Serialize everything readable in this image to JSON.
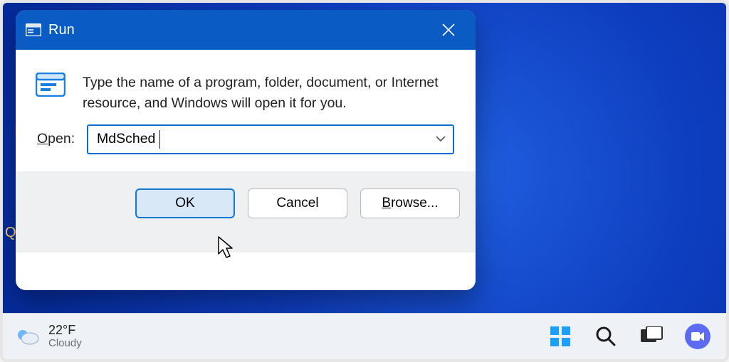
{
  "dialog": {
    "title": "Run",
    "description": "Type the name of a program, folder, document, or Internet resource, and Windows will open it for you.",
    "open_label_prefix": "O",
    "open_label_rest": "pen:",
    "input_value": "MdSched",
    "buttons": {
      "ok": "OK",
      "cancel": "Cancel",
      "browse_prefix": "B",
      "browse_rest": "rowse..."
    }
  },
  "taskbar": {
    "temperature": "22°F",
    "condition": "Cloudy"
  },
  "desktop": {
    "stray_letter": "Q"
  }
}
